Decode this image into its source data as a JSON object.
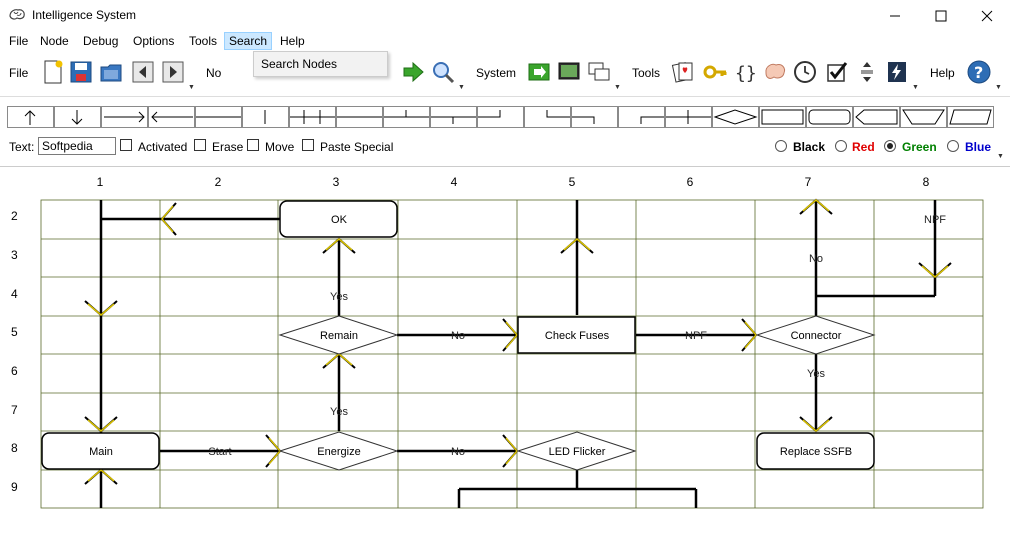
{
  "window": {
    "title": "Intelligence System"
  },
  "menu": [
    "File",
    "Node",
    "Debug",
    "Options",
    "Tools",
    "Search",
    "Help"
  ],
  "search_menu": {
    "item": "Search Nodes"
  },
  "toolbar": {
    "file_label": "File",
    "node_label": "No",
    "system_label": "System",
    "tools_label": "Tools",
    "help_label": "Help"
  },
  "options": {
    "text_label": "Text:",
    "text_value": "Softpedia",
    "activated": "Activated",
    "erase": "Erase",
    "move": "Move",
    "paste_special": "Paste Special",
    "colors": [
      {
        "label": "Black",
        "color": "#000000",
        "selected": false
      },
      {
        "label": "Red",
        "color": "#e00000",
        "selected": false
      },
      {
        "label": "Green",
        "color": "#008000",
        "selected": true
      },
      {
        "label": "Blue",
        "color": "#0000cc",
        "selected": false
      }
    ]
  },
  "grid": {
    "columns": [
      "1",
      "2",
      "3",
      "4",
      "5",
      "6",
      "7",
      "8"
    ],
    "rows": [
      "2",
      "3",
      "4",
      "5",
      "6",
      "7",
      "8",
      "9"
    ]
  },
  "nodes": {
    "ok": "OK",
    "remain": "Remain",
    "check_fuses": "Check Fuses",
    "connector": "Connector",
    "main": "Main",
    "energize": "Energize",
    "led_flicker": "LED Flicker",
    "replace_ssfb": "Replace SSFB"
  },
  "edge_labels": {
    "yes1": "Yes",
    "yes2": "Yes",
    "yes3": "Yes",
    "no1": "No",
    "no2": "No",
    "no3": "No",
    "npf1": "NPF",
    "npf2": "NPF",
    "start": "Start"
  }
}
